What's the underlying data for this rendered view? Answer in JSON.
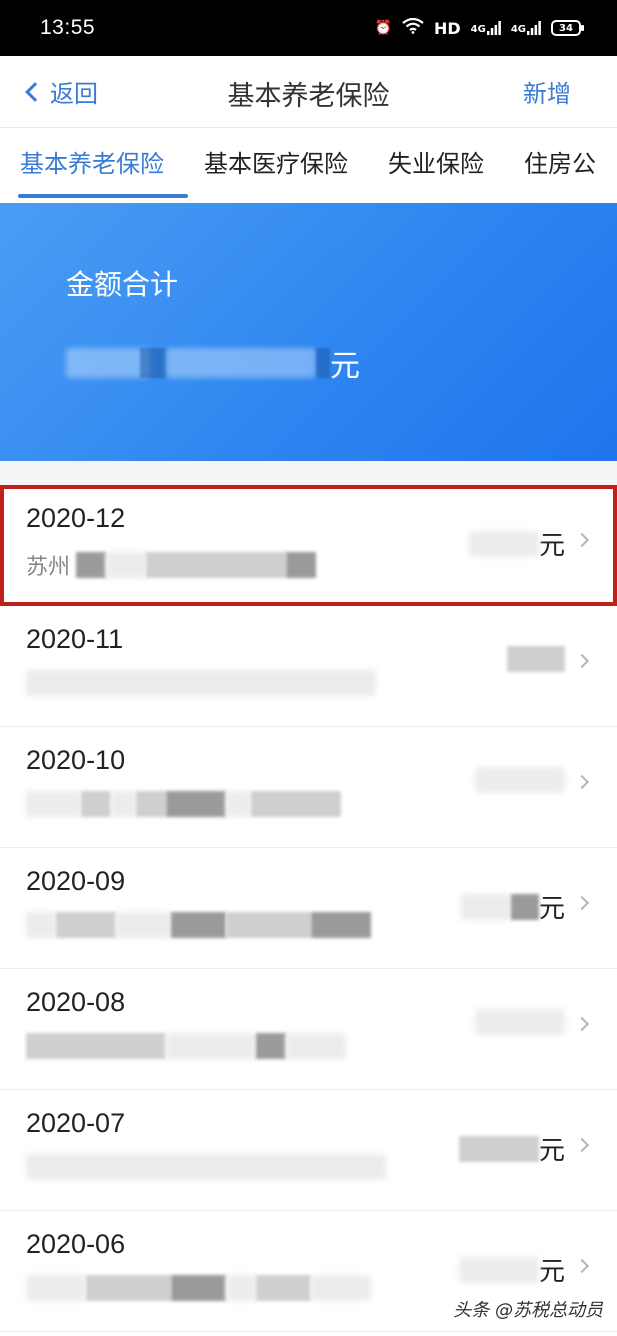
{
  "status_bar": {
    "time": "13:55",
    "hd_label": "HD",
    "net1": "4G",
    "net2": "4G",
    "battery": "34"
  },
  "nav": {
    "back_label": "返回",
    "title": "基本养老保险",
    "add_label": "新增"
  },
  "tabs": [
    {
      "label": "基本养老保险",
      "active": true
    },
    {
      "label": "基本医疗保险",
      "active": false
    },
    {
      "label": "失业保险",
      "active": false
    },
    {
      "label": "住房公",
      "active": false
    }
  ],
  "summary": {
    "label": "金额合计",
    "unit": "元"
  },
  "records": [
    {
      "month": "2020-12",
      "company_prefix": "苏州",
      "unit": "元"
    },
    {
      "month": "2020-11",
      "company_prefix": "",
      "unit": ""
    },
    {
      "month": "2020-10",
      "company_prefix": "",
      "unit": ""
    },
    {
      "month": "2020-09",
      "company_prefix": "",
      "unit": "元"
    },
    {
      "month": "2020-08",
      "company_prefix": "",
      "unit": ""
    },
    {
      "month": "2020-07",
      "company_prefix": "",
      "unit": "元"
    },
    {
      "month": "2020-06",
      "company_prefix": "",
      "unit": "元"
    }
  ],
  "watermark": "头条 @苏税总动员",
  "colors": {
    "accent": "#3a7bd5",
    "highlight_border": "#c0201a"
  }
}
